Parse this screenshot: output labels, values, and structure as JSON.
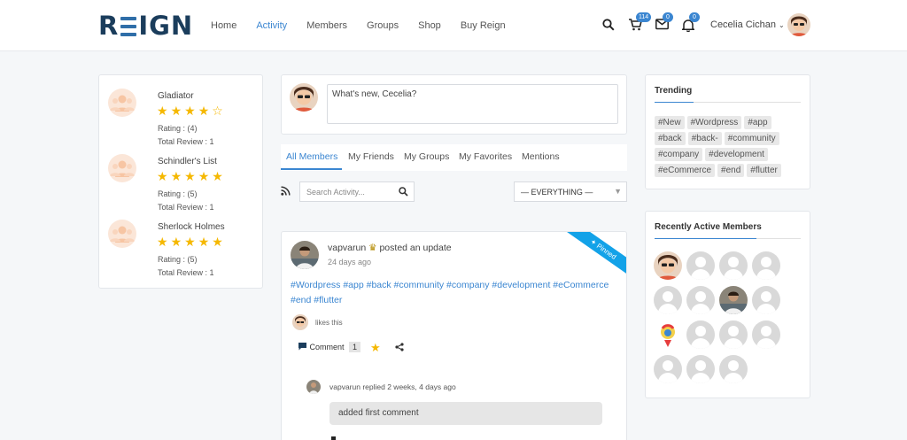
{
  "header": {
    "logo": "REIGN",
    "nav": [
      {
        "label": "Home",
        "active": false
      },
      {
        "label": "Activity",
        "active": true
      },
      {
        "label": "Members",
        "active": false
      },
      {
        "label": "Groups",
        "active": false
      },
      {
        "label": "Shop",
        "active": false
      },
      {
        "label": "Buy Reign",
        "active": false
      }
    ],
    "cart_count": "114",
    "messages_count": "0",
    "notifications_count": "0",
    "user_name": "Cecelia Cichan",
    "accent": "#3b86d1"
  },
  "reviews": [
    {
      "title": "Gladiator",
      "stars": 4,
      "rating": "Rating : (4)",
      "total": "Total Review : 1"
    },
    {
      "title": "Schindler's List",
      "stars": 5,
      "rating": "Rating : (5)",
      "total": "Total Review : 1"
    },
    {
      "title": "Sherlock Holmes",
      "stars": 5,
      "rating": "Rating : (5)",
      "total": "Total Review : 1"
    }
  ],
  "post_box": {
    "placeholder": "What's new, Cecelia?"
  },
  "tabs": [
    "All Members",
    "My Friends",
    "My Groups",
    "My Favorites",
    "Mentions"
  ],
  "search": {
    "placeholder": "Search Activity..."
  },
  "filter": {
    "selected": "— EVERYTHING —"
  },
  "activity": {
    "pinned_label": "Pinned",
    "author": "vapvarun",
    "action": "posted an update",
    "time": "24 days ago",
    "tags_line1": "#Wordpress #app #back #community #company #development #eCommerce",
    "tags_line2": "#end #flutter",
    "likes_text": "likes this",
    "comment_label": "Comment",
    "comment_count": "1",
    "reply_author": "vapvarun",
    "reply_meta": "replied 2 weeks, 4 days ago",
    "reply_text": "added first comment"
  },
  "trending": {
    "title": "Trending",
    "tags": [
      "#New",
      "#Wordpress",
      "#app",
      "#back",
      "#back-",
      "#community",
      "#company",
      "#development",
      "#eCommerce",
      "#end",
      "#flutter"
    ]
  },
  "recent_members": {
    "title": "Recently Active Members"
  },
  "colors": {
    "star": "#f5b800",
    "pinned": "#13a2e8"
  }
}
